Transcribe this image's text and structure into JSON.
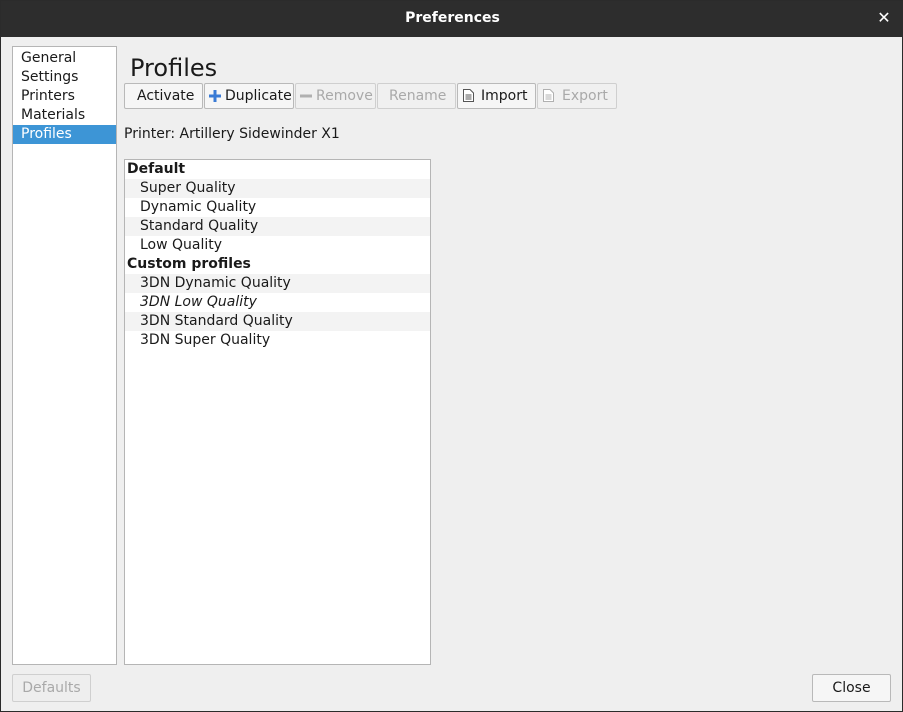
{
  "window": {
    "title": "Preferences",
    "close_glyph": "✕"
  },
  "nav": {
    "items": [
      {
        "label": "General",
        "selected": false
      },
      {
        "label": "Settings",
        "selected": false
      },
      {
        "label": "Printers",
        "selected": false
      },
      {
        "label": "Materials",
        "selected": false
      },
      {
        "label": "Profiles",
        "selected": true
      }
    ],
    "selected_color": "#3d95d6"
  },
  "page": {
    "title": "Profiles",
    "printer_label": "Printer: Artillery Sidewinder X1"
  },
  "toolbar": {
    "activate": {
      "label": "Activate",
      "enabled": true
    },
    "duplicate": {
      "label": "Duplicate",
      "enabled": true,
      "icon": "plus-icon"
    },
    "remove": {
      "label": "Remove",
      "enabled": false,
      "icon": "minus-icon"
    },
    "rename": {
      "label": "Rename",
      "enabled": false
    },
    "import": {
      "label": "Import",
      "enabled": true,
      "icon": "document-icon"
    },
    "export": {
      "label": "Export",
      "enabled": false,
      "icon": "document-icon"
    }
  },
  "profiles": {
    "groups": [
      {
        "header": "Default",
        "items": [
          {
            "label": "Super Quality",
            "italic": false
          },
          {
            "label": "Dynamic Quality",
            "italic": false
          },
          {
            "label": "Standard Quality",
            "italic": false
          },
          {
            "label": "Low Quality",
            "italic": false
          }
        ]
      },
      {
        "header": "Custom profiles",
        "items": [
          {
            "label": "3DN Dynamic Quality",
            "italic": false
          },
          {
            "label": "3DN Low Quality",
            "italic": true
          },
          {
            "label": "3DN Standard Quality",
            "italic": false
          },
          {
            "label": "3DN Super Quality",
            "italic": false
          }
        ]
      }
    ]
  },
  "footer": {
    "defaults": {
      "label": "Defaults",
      "enabled": false
    },
    "close": {
      "label": "Close",
      "enabled": true
    }
  }
}
